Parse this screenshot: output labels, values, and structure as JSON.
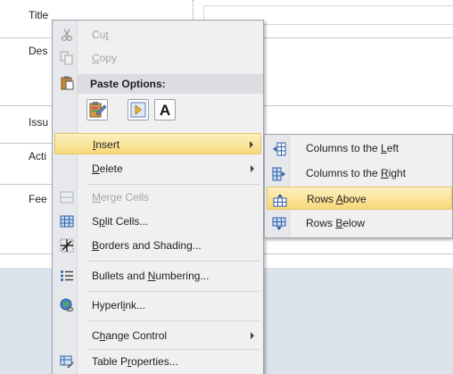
{
  "document": {
    "row_labels": [
      "Title",
      "Des",
      "Issu",
      "Acti",
      "Fee"
    ]
  },
  "context_menu": {
    "items": [
      {
        "pre": "Cu",
        "ul": "t",
        "post": "",
        "disabled": true
      },
      {
        "pre": "",
        "ul": "C",
        "post": "opy",
        "disabled": true
      },
      {
        "pre": "",
        "ul": "I",
        "post": "nsert",
        "highlight": true,
        "submenu": true
      },
      {
        "pre": "",
        "ul": "D",
        "post": "elete",
        "submenu": true
      },
      {
        "pre": "",
        "ul": "M",
        "post": "erge Cells",
        "disabled": true
      },
      {
        "pre": "S",
        "ul": "p",
        "post": "lit Cells...",
        "disabled": false
      },
      {
        "pre": "",
        "ul": "B",
        "post": "orders and Shading..."
      },
      {
        "pre": "Bullets and ",
        "ul": "N",
        "post": "umbering..."
      },
      {
        "pre": "Hyperl",
        "ul": "i",
        "post": "nk..."
      },
      {
        "pre": "C",
        "ul": "h",
        "post": "ange Control",
        "submenu": true
      },
      {
        "pre": "Table P",
        "ul": "r",
        "post": "operties..."
      }
    ],
    "paste_options_label": "Paste Options:",
    "paste_button_letter": "A"
  },
  "submenu": {
    "items": [
      {
        "pre": "Columns to the ",
        "ul": "L",
        "post": "eft"
      },
      {
        "pre": "Columns to the ",
        "ul": "R",
        "post": "ight"
      },
      {
        "pre": "Rows ",
        "ul": "A",
        "post": "bove",
        "highlight": true
      },
      {
        "pre": "Rows ",
        "ul": "B",
        "post": "elow"
      }
    ]
  },
  "colors": {
    "highlight_top": "#fdf0c0",
    "highlight_bottom": "#f8d97a",
    "menu_bg": "#f0f0f0",
    "doc_lower": "#dde3ec"
  }
}
